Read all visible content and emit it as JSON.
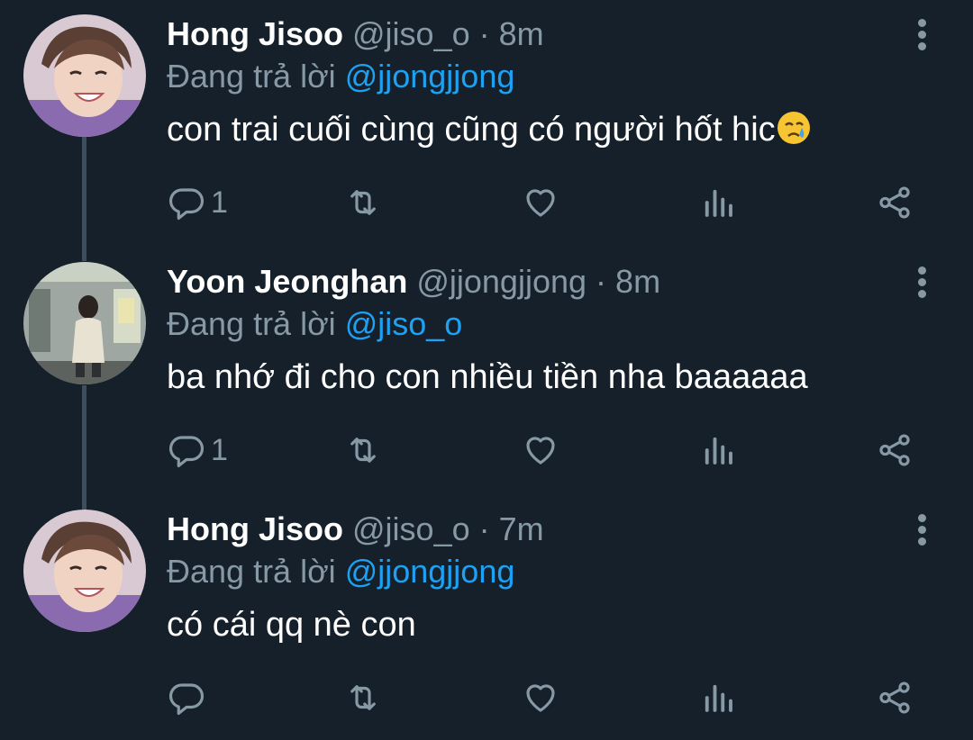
{
  "tweets": [
    {
      "name": "Hong Jisoo",
      "handle": "@jiso_o",
      "separator": "·",
      "time": "8m",
      "replying_prefix": "Đang trả lời",
      "replying_to": "@jjongjjong",
      "text": "con trai cuối cùng cũng có người hốt hic",
      "emoji": "crying-face-emoji",
      "reply_count": "1"
    },
    {
      "name": "Yoon Jeonghan",
      "handle": "@jjongjjong",
      "separator": "·",
      "time": "8m",
      "replying_prefix": "Đang trả lời",
      "replying_to": "@jiso_o",
      "text": "ba nhớ đi cho con nhiều tiền nha baaaaaa",
      "reply_count": "1"
    },
    {
      "name": "Hong Jisoo",
      "handle": "@jiso_o",
      "separator": "·",
      "time": "7m",
      "replying_prefix": "Đang trả lời",
      "replying_to": "@jjongjjong",
      "text": "có cái qq nè con",
      "reply_count": ""
    }
  ],
  "icons": {
    "reply": "reply-icon",
    "retweet": "retweet-icon",
    "like": "like-icon",
    "analytics": "analytics-icon",
    "share": "share-icon",
    "more": "more-options-icon"
  },
  "colors": {
    "background": "#15202b",
    "name": "#ffffff",
    "muted": "#8899a6",
    "mention": "#1da1f2",
    "thread_line": "#3d4f5f"
  }
}
